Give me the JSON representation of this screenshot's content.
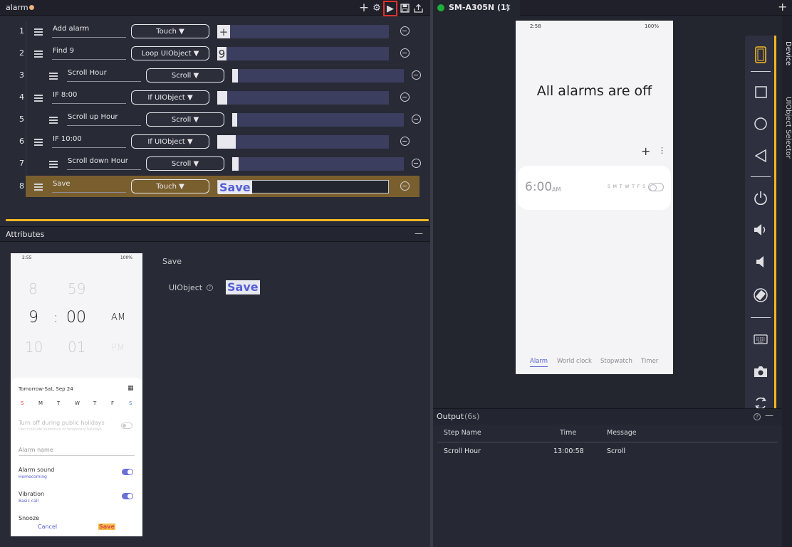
{
  "editor": {
    "tab_title": "alarm",
    "toolbar_icons": [
      "plus-icon",
      "gear-icon",
      "play-icon",
      "save-icon",
      "export-icon"
    ]
  },
  "steps": [
    {
      "num": "1",
      "name": "Add alarm",
      "action": "Touch ▼",
      "thumb": "+",
      "indent": 0
    },
    {
      "num": "2",
      "name": "Find 9",
      "action": "Loop UIObject ▼",
      "thumb": "9",
      "indent": 0
    },
    {
      "num": "3",
      "name": "Scroll Hour",
      "action": "Scroll ▼",
      "thumb": "",
      "indent": 1
    },
    {
      "num": "4",
      "name": "IF 8:00",
      "action": "If UIObject ▼",
      "thumb": "",
      "indent": 0
    },
    {
      "num": "5",
      "name": "Scroll up Hour",
      "action": "Scroll ▼",
      "thumb": "",
      "indent": 1
    },
    {
      "num": "6",
      "name": "IF 10:00",
      "action": "If UIObject ▼",
      "thumb": "",
      "indent": 0
    },
    {
      "num": "7",
      "name": "Scroll down Hour",
      "action": "Scroll ▼",
      "thumb": "",
      "indent": 1
    },
    {
      "num": "8",
      "name": "Save",
      "action": "Touch ▼",
      "thumb": "Save",
      "indent": 0
    }
  ],
  "attributes": {
    "title": "Attributes",
    "step_name": "Save",
    "field_label": "UIObject",
    "field_value": "Save",
    "screenshot": {
      "time": "2:55",
      "battery": "100%",
      "hour_prev": "8",
      "min_prev": "59",
      "hour": "9",
      "colon": ":",
      "minute": "00",
      "am": "AM",
      "hour_next": "10",
      "min_next": "01",
      "pm": "PM",
      "date": "Tomorrow-Sat, Sep 24",
      "days": [
        "S",
        "M",
        "T",
        "W",
        "T",
        "F",
        "S"
      ],
      "holidays": "Turn off during public holidays",
      "holidays_sub": "Don't include substitute or temporary holidays",
      "alarm_name": "Alarm name",
      "sound": "Alarm sound",
      "sound_sub": "Homecoming",
      "vibration": "Vibration",
      "vibration_sub": "Basic call",
      "snooze": "Snooze",
      "cancel": "Cancel",
      "save": "Save"
    }
  },
  "device": {
    "tab_title": "SM-A305N  (1)",
    "phone": {
      "time": "2:58",
      "battery": "100%",
      "headline": "All alarms are off",
      "alarm_time": "6:00",
      "alarm_ampm": "AM",
      "days": "S M T W T F S",
      "nav": [
        "Alarm",
        "World clock",
        "Stopwatch",
        "Timer"
      ]
    },
    "side_tabs": [
      "Device",
      "UIObject Selector"
    ],
    "controls": [
      "portrait-icon",
      "square-icon",
      "home-circle-icon",
      "back-triangle-icon",
      "power-icon",
      "volume-up-icon",
      "volume-down-icon",
      "rotate-icon",
      "keyboard-icon",
      "camera-icon",
      "refresh-icon"
    ]
  },
  "output": {
    "title": "Output",
    "duration": "(6s)",
    "columns": [
      "Step Name",
      "Time",
      "Message"
    ],
    "rows": [
      {
        "step": "Scroll Hour",
        "time": "13:00:58",
        "message": "Scroll"
      }
    ]
  },
  "colors": {
    "accent_yellow": "#f2b722",
    "active_row": "#7a5f2e",
    "run_highlight": "#e0302a",
    "device_online": "#1fae3a",
    "link_blue": "#5560d6"
  }
}
